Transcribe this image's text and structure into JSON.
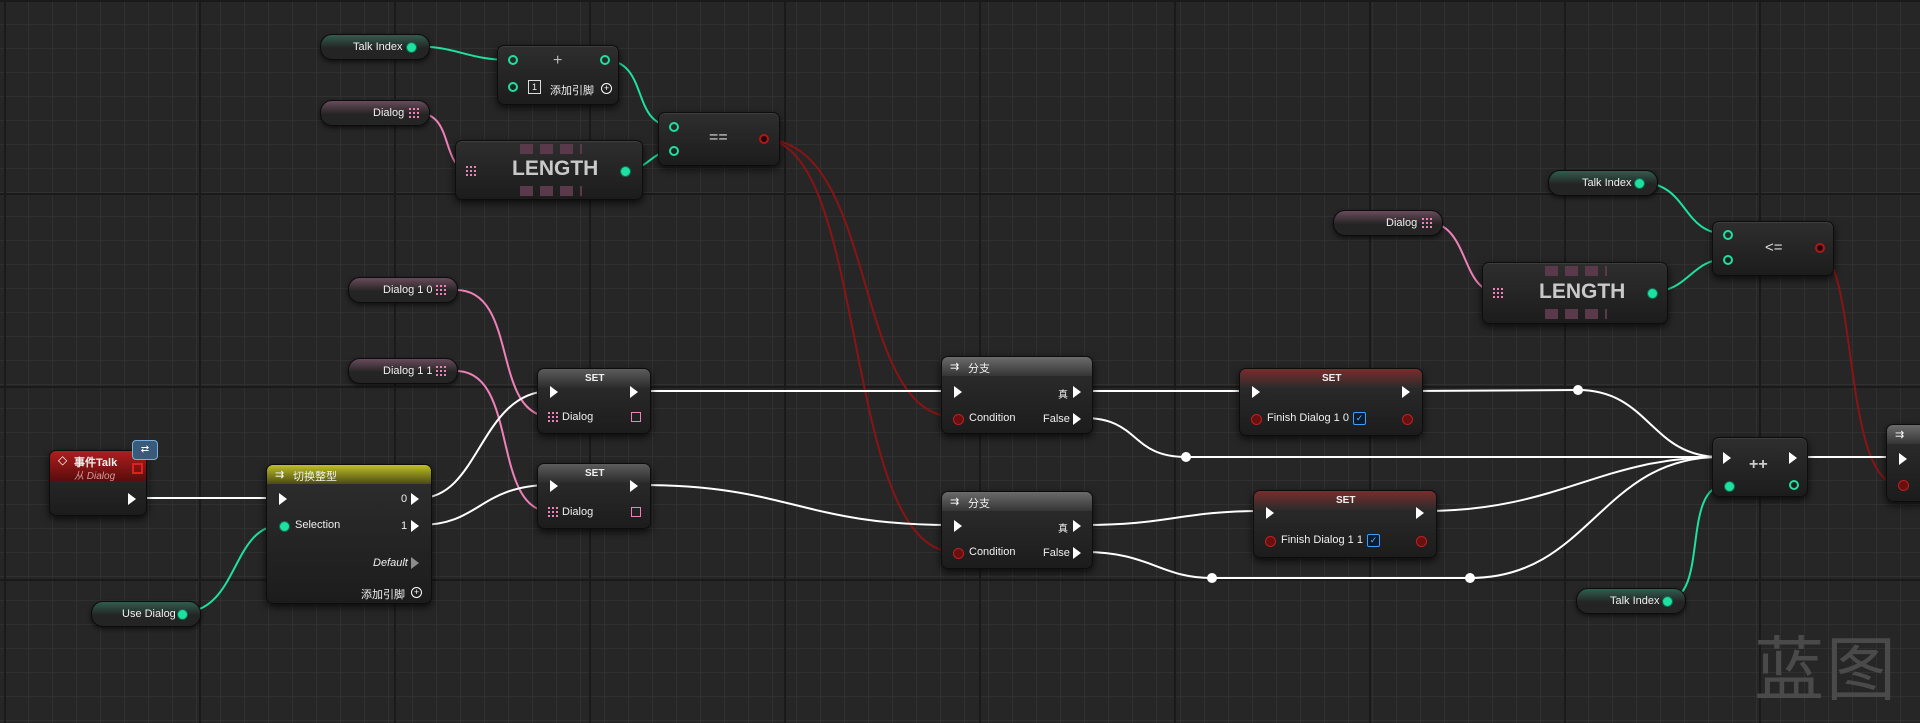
{
  "watermark": "蓝图",
  "variables": {
    "talk_index": "Talk Index",
    "dialog": "Dialog",
    "dialog_1_0": "Dialog 1 0",
    "dialog_1_1": "Dialog 1 1",
    "use_dialog": "Use Dialog"
  },
  "nodes": {
    "add": {
      "symbol": "+",
      "add_pin": "添加引脚",
      "literal": "1"
    },
    "length_label": "LENGTH",
    "equals": {
      "symbol": "=="
    },
    "less_equal": {
      "symbol": "<="
    },
    "increment": {
      "symbol": "++"
    },
    "event": {
      "title": "事件Talk",
      "subtitle": "从 Dialog"
    },
    "switch": {
      "title": "切换整型",
      "selection": "Selection",
      "out0": "0",
      "out1": "1",
      "default": "Default",
      "add_pin": "添加引脚"
    },
    "set_label": "SET",
    "set_dialog_pin": "Dialog",
    "branch": {
      "title": "分支",
      "condition": "Condition",
      "true": "真",
      "false": "False"
    },
    "set_finish_0": {
      "title": "SET",
      "pin": "Finish Dialog 1 0"
    },
    "set_finish_1": {
      "title": "SET",
      "pin": "Finish Dialog 1 1"
    }
  },
  "colors": {
    "integer_pin": "#1ee0a0",
    "array_pin": "#f080b8",
    "bool_pin": "#b01818",
    "exec_wire": "#ffffff",
    "event_header": "#b01e1e",
    "switch_header": "#bfbf24"
  }
}
